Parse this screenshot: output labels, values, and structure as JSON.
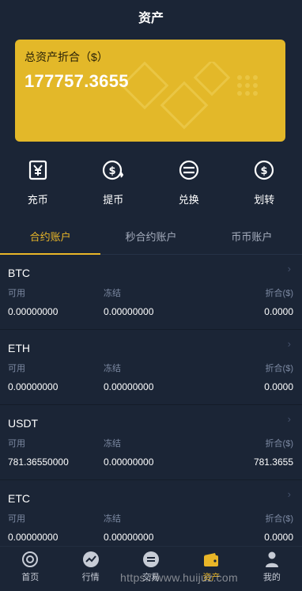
{
  "header": {
    "title": "资产"
  },
  "card": {
    "label": "总资产折合（$）",
    "value": "177757.3655"
  },
  "actions": [
    {
      "label": "充币",
      "icon": "deposit-icon"
    },
    {
      "label": "提币",
      "icon": "withdraw-icon"
    },
    {
      "label": "兑换",
      "icon": "exchange-icon"
    },
    {
      "label": "划转",
      "icon": "transfer-icon"
    }
  ],
  "tabs": [
    {
      "label": "合约账户",
      "active": true
    },
    {
      "label": "秒合约账户",
      "active": false
    },
    {
      "label": "币币账户",
      "active": false
    }
  ],
  "columns": {
    "available": "可用",
    "frozen": "冻结",
    "converted": "折合($)"
  },
  "accounts": [
    {
      "coin": "BTC",
      "available": "0.00000000",
      "frozen": "0.00000000",
      "converted": "0.0000"
    },
    {
      "coin": "ETH",
      "available": "0.00000000",
      "frozen": "0.00000000",
      "converted": "0.0000"
    },
    {
      "coin": "USDT",
      "available": "781.36550000",
      "frozen": "0.00000000",
      "converted": "781.3655"
    },
    {
      "coin": "ETC",
      "available": "0.00000000",
      "frozen": "0.00000000",
      "converted": "0.0000"
    }
  ],
  "tabbar": [
    {
      "label": "首页",
      "icon": "home-icon",
      "active": false
    },
    {
      "label": "行情",
      "icon": "market-icon",
      "active": false
    },
    {
      "label": "交易",
      "icon": "trade-icon",
      "active": false
    },
    {
      "label": "资产",
      "icon": "wallet-icon",
      "active": true
    },
    {
      "label": "我的",
      "icon": "user-icon",
      "active": false
    }
  ],
  "watermark": "https://www.huijuz.com",
  "colors": {
    "accent": "#e9b628",
    "background": "#1b2536",
    "card": "#e3b829"
  }
}
